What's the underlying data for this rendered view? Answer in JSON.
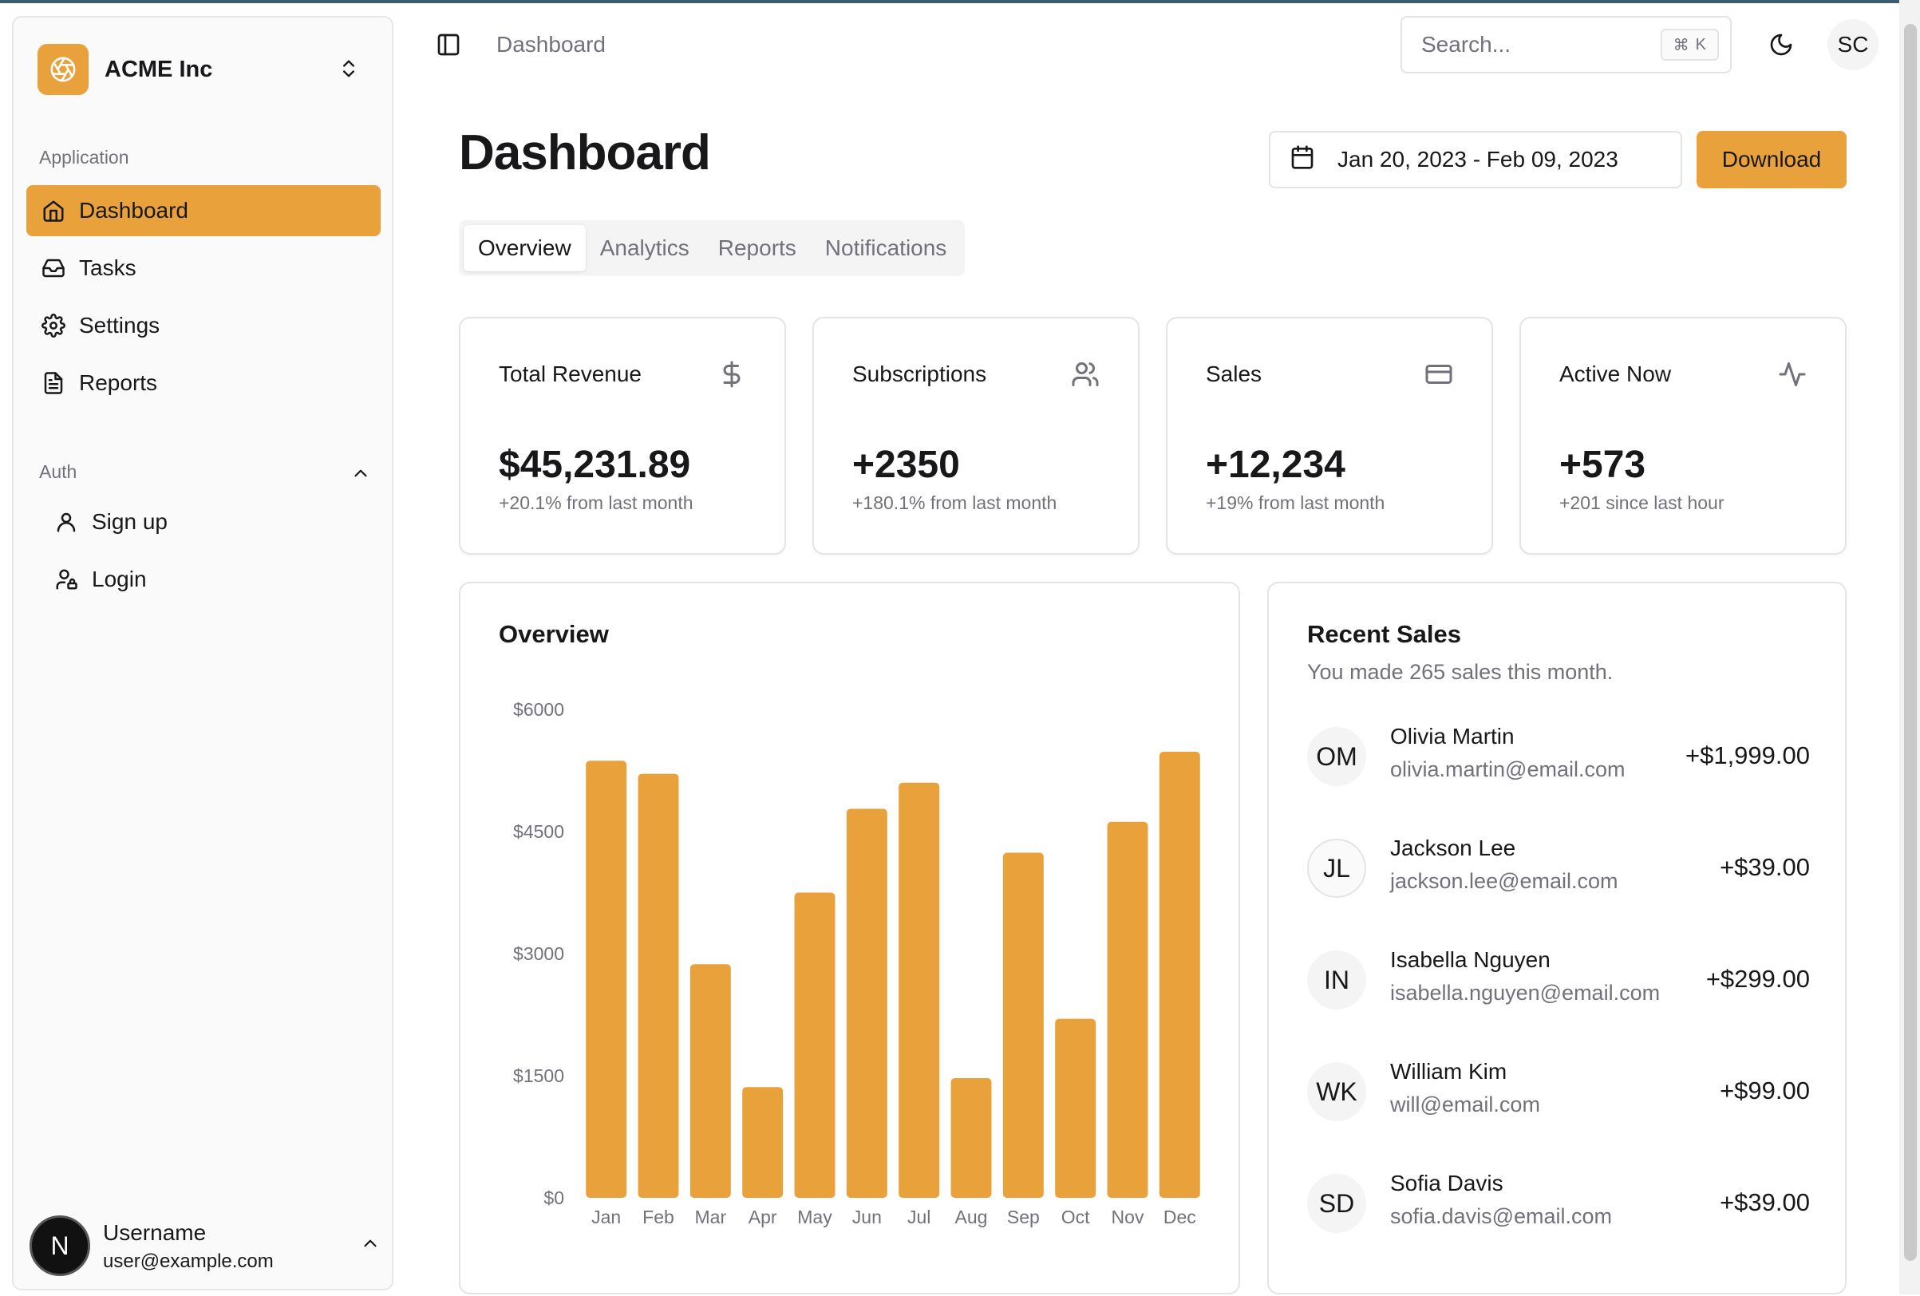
{
  "sidebar": {
    "brand": "ACME Inc",
    "group_application": "Application",
    "items": [
      {
        "label": "Dashboard",
        "icon": "home-icon",
        "active": true
      },
      {
        "label": "Tasks",
        "icon": "inbox-icon"
      },
      {
        "label": "Settings",
        "icon": "gear-icon"
      },
      {
        "label": "Reports",
        "icon": "file-text-icon"
      }
    ],
    "group_auth": "Auth",
    "auth_items": [
      {
        "label": "Sign up",
        "icon": "user-icon"
      },
      {
        "label": "Login",
        "icon": "user-lock-icon"
      }
    ],
    "user": {
      "initial": "N",
      "name": "Username",
      "email": "user@example.com"
    }
  },
  "topbar": {
    "breadcrumb": "Dashboard",
    "search_placeholder": "Search...",
    "search_kbd_symbol": "⌘",
    "search_kbd_key": "K",
    "avatar": "SC"
  },
  "page": {
    "title": "Dashboard",
    "date_range": "Jan 20, 2023 - Feb 09, 2023",
    "download": "Download"
  },
  "tabs": [
    "Overview",
    "Analytics",
    "Reports",
    "Notifications"
  ],
  "stats": [
    {
      "title": "Total Revenue",
      "value": "$45,231.89",
      "sub": "+20.1% from last month",
      "icon": "dollar-icon"
    },
    {
      "title": "Subscriptions",
      "value": "+2350",
      "sub": "+180.1% from last month",
      "icon": "users-icon"
    },
    {
      "title": "Sales",
      "value": "+12,234",
      "sub": "+19% from last month",
      "icon": "credit-card-icon"
    },
    {
      "title": "Active Now",
      "value": "+573",
      "sub": "+201 since last hour",
      "icon": "activity-icon"
    }
  ],
  "overview": {
    "title": "Overview"
  },
  "chart_data": {
    "type": "bar",
    "categories": [
      "Jan",
      "Feb",
      "Mar",
      "Apr",
      "May",
      "Jun",
      "Jul",
      "Aug",
      "Sep",
      "Oct",
      "Nov",
      "Dec"
    ],
    "values": [
      5370,
      5210,
      2870,
      1360,
      3750,
      4780,
      5100,
      1470,
      4240,
      2200,
      4620,
      5480
    ],
    "ylim": [
      0,
      6000
    ],
    "yticks": [
      "$0",
      "$1500",
      "$3000",
      "$4500",
      "$6000"
    ],
    "color": "#e9a23b",
    "grid": false
  },
  "recent_sales": {
    "title": "Recent Sales",
    "description": "You made 265 sales this month.",
    "rows": [
      {
        "initials": "OM",
        "name": "Olivia Martin",
        "email": "olivia.martin@email.com",
        "amount": "+$1,999.00"
      },
      {
        "initials": "JL",
        "name": "Jackson Lee",
        "email": "jackson.lee@email.com",
        "amount": "+$39.00"
      },
      {
        "initials": "IN",
        "name": "Isabella Nguyen",
        "email": "isabella.nguyen@email.com",
        "amount": "+$299.00"
      },
      {
        "initials": "WK",
        "name": "William Kim",
        "email": "will@email.com",
        "amount": "+$99.00"
      },
      {
        "initials": "SD",
        "name": "Sofia Davis",
        "email": "sofia.davis@email.com",
        "amount": "+$39.00"
      }
    ]
  },
  "colors": {
    "accent": "#e9a23b",
    "muted_text": "#71717a",
    "border": "#e4e4e7"
  }
}
